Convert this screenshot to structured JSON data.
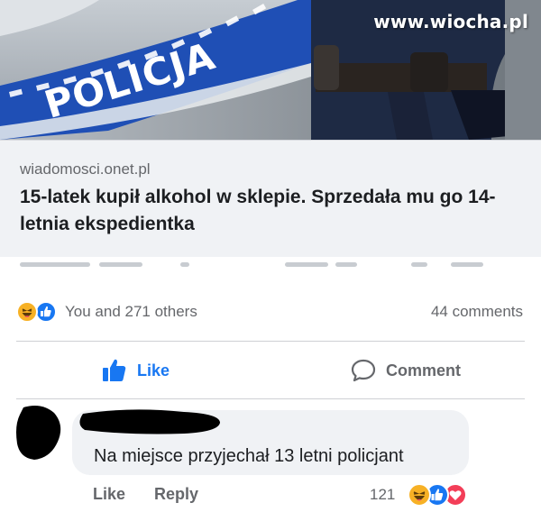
{
  "hero": {
    "vehicle_text": "POLICJA",
    "watermark": "www.wiocha.pl"
  },
  "link": {
    "domain": "wiadomosci.onet.pl",
    "title": "15-latek kupił alkohol w sklepie. Sprzedała mu go 14-letnia ekspedientka"
  },
  "reactions": {
    "icons": [
      "haha-icon",
      "like-icon"
    ],
    "summary": "You and 271 others",
    "comments": "44 comments"
  },
  "actions": {
    "like_label": "Like",
    "comment_label": "Comment"
  },
  "comment": {
    "author_redacted": true,
    "text": "Na miejsce przyjechał 13 letni policjant",
    "like_label": "Like",
    "reply_label": "Reply",
    "reaction_count": "121",
    "reaction_icons": [
      "haha-icon",
      "like-icon",
      "love-icon"
    ]
  },
  "colors": {
    "link_blue": "#1877f2",
    "secondary_text": "#65676b",
    "bubble_bg": "#f0f2f5",
    "police_blue": "#1f4fb5"
  }
}
